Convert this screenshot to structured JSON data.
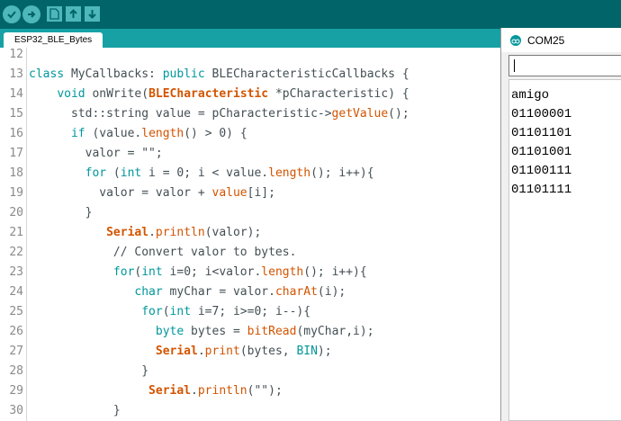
{
  "toolbar": {
    "verify_icon": "check-icon",
    "upload_icon": "arrow-right-icon",
    "new_icon": "page-icon",
    "open_icon": "arrow-up-icon",
    "save_icon": "arrow-down-icon"
  },
  "tab": {
    "label": "ESP32_BLE_Bytes"
  },
  "editor": {
    "line_numbers": [
      "12",
      "13",
      "14",
      "15",
      "16",
      "17",
      "18",
      "19",
      "20",
      "21",
      "22",
      "23",
      "24",
      "25",
      "26",
      "27",
      "28",
      "29",
      "30"
    ],
    "colors": {
      "keyword": "#00979c",
      "function": "#d35400",
      "text": "#434f54"
    }
  },
  "serial": {
    "title": "COM25",
    "input_value": "",
    "partial_top": "···",
    "output": [
      "amigo",
      "01100001",
      "01101101",
      "01101001",
      "01100111",
      "01101111"
    ]
  }
}
